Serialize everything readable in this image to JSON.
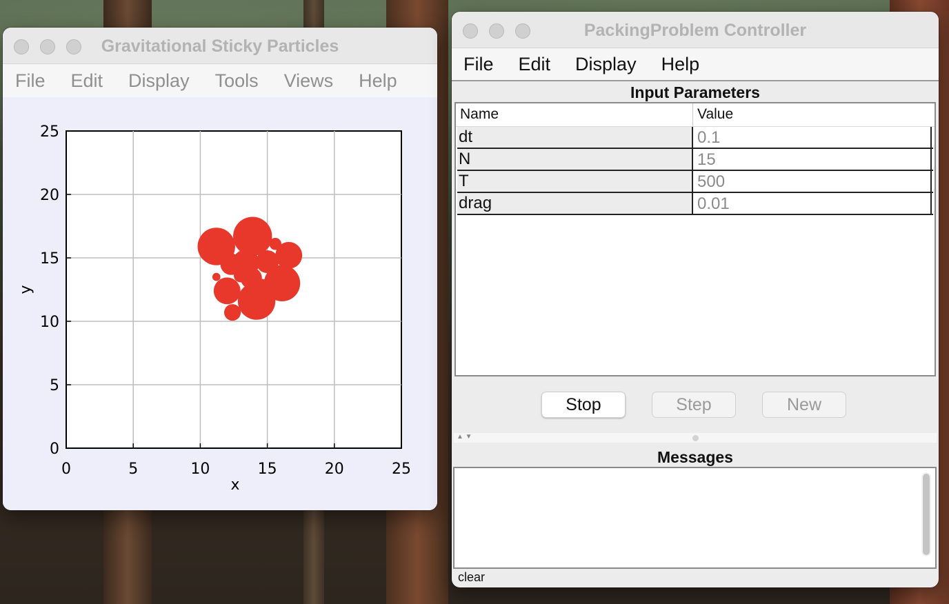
{
  "desktop": {
    "background": "forest"
  },
  "left_window": {
    "title": "Gravitational Sticky Particles",
    "menu": [
      "File",
      "Edit",
      "Display",
      "Tools",
      "Views",
      "Help"
    ]
  },
  "right_window": {
    "title": "PackingProblem Controller",
    "menu": [
      "File",
      "Edit",
      "Display",
      "Help"
    ],
    "parameters_title": "Input Parameters",
    "table": {
      "headers": [
        "Name",
        "Value"
      ],
      "rows": [
        {
          "name": "dt",
          "value": "0.1"
        },
        {
          "name": "N",
          "value": "15"
        },
        {
          "name": "T",
          "value": "500"
        },
        {
          "name": "drag",
          "value": "0.01"
        }
      ]
    },
    "buttons": [
      {
        "label": "Stop",
        "enabled": true
      },
      {
        "label": "Step",
        "enabled": false
      },
      {
        "label": "New",
        "enabled": false
      }
    ],
    "messages_title": "Messages",
    "messages": "",
    "clear_label": "clear"
  },
  "chart_data": {
    "type": "scatter",
    "xlabel": "x",
    "ylabel": "y",
    "xlim": [
      0,
      25
    ],
    "ylim": [
      0,
      25
    ],
    "xticks": [
      "0",
      "5",
      "10",
      "15",
      "20",
      "25"
    ],
    "yticks": [
      "0",
      "5",
      "10",
      "15",
      "20",
      "25"
    ],
    "grid": true,
    "marker_color": "#e8382c",
    "particles": [
      {
        "x": 11.2,
        "y": 15.9,
        "r": 1.4
      },
      {
        "x": 13.9,
        "y": 16.7,
        "r": 1.45
      },
      {
        "x": 16.6,
        "y": 15.2,
        "r": 1.0
      },
      {
        "x": 15.6,
        "y": 16.1,
        "r": 0.45
      },
      {
        "x": 12.3,
        "y": 14.5,
        "r": 0.8
      },
      {
        "x": 13.4,
        "y": 14.6,
        "r": 1.0
      },
      {
        "x": 15.0,
        "y": 14.7,
        "r": 0.85
      },
      {
        "x": 11.2,
        "y": 13.5,
        "r": 0.3
      },
      {
        "x": 13.8,
        "y": 13.4,
        "r": 0.8
      },
      {
        "x": 16.1,
        "y": 13.0,
        "r": 1.35
      },
      {
        "x": 12.0,
        "y": 12.4,
        "r": 1.0
      },
      {
        "x": 14.2,
        "y": 11.6,
        "r": 1.4
      },
      {
        "x": 12.4,
        "y": 10.7,
        "r": 0.62
      },
      {
        "x": 14.6,
        "y": 12.6,
        "r": 0.7
      },
      {
        "x": 13.0,
        "y": 13.6,
        "r": 0.5
      }
    ]
  }
}
